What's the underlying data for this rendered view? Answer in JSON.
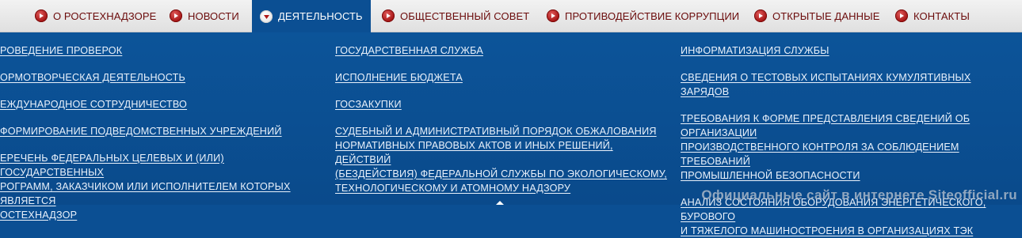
{
  "nav": {
    "items": [
      {
        "label": "О РОСТЕХНАДЗОРЕ",
        "active": false
      },
      {
        "label": "НОВОСТИ",
        "active": false
      },
      {
        "label": "ДЕЯТЕЛЬНОСТЬ",
        "active": true
      },
      {
        "label": "ОБЩЕСТВЕННЫЙ СОВЕТ",
        "active": false
      },
      {
        "label": "ПРОТИВОДЕЙСТВИЕ КОРРУПЦИИ",
        "active": false
      },
      {
        "label": "ОТКРЫТЫЕ ДАННЫЕ",
        "active": false
      },
      {
        "label": "КОНТАКТЫ",
        "active": false
      }
    ]
  },
  "menu": {
    "col1": [
      "РОВЕДЕНИЕ ПРОВЕРОК",
      "ОРМОТВОРЧЕСКАЯ ДЕЯТЕЛЬНОСТЬ",
      "ЕЖДУНАРОДНОЕ СОТРУДНИЧЕСТВО",
      "ФОРМИРОВАНИЕ ПОДВЕДОМСТВЕННЫХ УЧРЕЖДЕНИЙ",
      "ЕРЕЧЕНЬ ФЕДЕРАЛЬНЫХ ЦЕЛЕВЫХ И (ИЛИ) ГОСУДАРСТВЕННЫХ\nРОГРАММ, ЗАКАЗЧИКОМ ИЛИ ИСПОЛНИТЕЛЕМ КОТОРЫХ ЯВЛЯЕТСЯ\nОСТЕХНАДЗОР"
    ],
    "col2": [
      "ГОСУДАРСТВЕННАЯ СЛУЖБА",
      "ИСПОЛНЕНИЕ БЮДЖЕТА",
      "ГОСЗАКУПКИ",
      "СУДЕБНЫЙ И АДМИНИСТРАТИВНЫЙ ПОРЯДОК ОБЖАЛОВАНИЯ\nНОРМАТИВНЫХ ПРАВОВЫХ АКТОВ И ИНЫХ РЕШЕНИЙ, ДЕЙСТВИЙ\n(БЕЗДЕЙСТВИЯ) ФЕДЕРАЛЬНОЙ СЛУЖБЫ ПО ЭКОЛОГИЧЕСКОМУ,\nТЕХНОЛОГИЧЕСКОМУ И АТОМНОМУ НАДЗОРУ"
    ],
    "col3": [
      "ИНФОРМАТИЗАЦИЯ СЛУЖБЫ",
      "СВЕДЕНИЯ О ТЕСТОВЫХ ИСПЫТАНИЯХ КУМУЛЯТИВНЫХ ЗАРЯДОВ",
      "ТРЕБОВАНИЯ К ФОРМЕ ПРЕДСТАВЛЕНИЯ СВЕДЕНИЙ ОБ ОРГАНИЗАЦИИ\nПРОИЗВОДСТВЕННОГО КОНТРОЛЯ ЗА СОБЛЮДЕНИЕМ ТРЕБОВАНИЙ\nПРОМЫШЛЕННОЙ БЕЗОПАСНОСТИ",
      "АНАЛИЗ СОСТОЯНИЯ ОБОРУДОВАНИЯ ЭНЕРГЕТИЧЕСКОГО, БУРОВОГО\nИ ТЯЖЕЛОГО МАШИНОСТРОЕНИЯ В ОРГАНИЗАЦИЯХ ТЭК"
    ]
  },
  "watermark": "Официальные сайт в интернете Siteofficial.ru",
  "icons": {
    "nav_bullet": "play-circle-icon",
    "active_bullet": "chevron-down-circle-icon"
  },
  "colors": {
    "nav_text": "#6b0b0b",
    "panel_bg": "#0b4f93",
    "link": "#e9f1fb",
    "bullet": "#b01818"
  }
}
